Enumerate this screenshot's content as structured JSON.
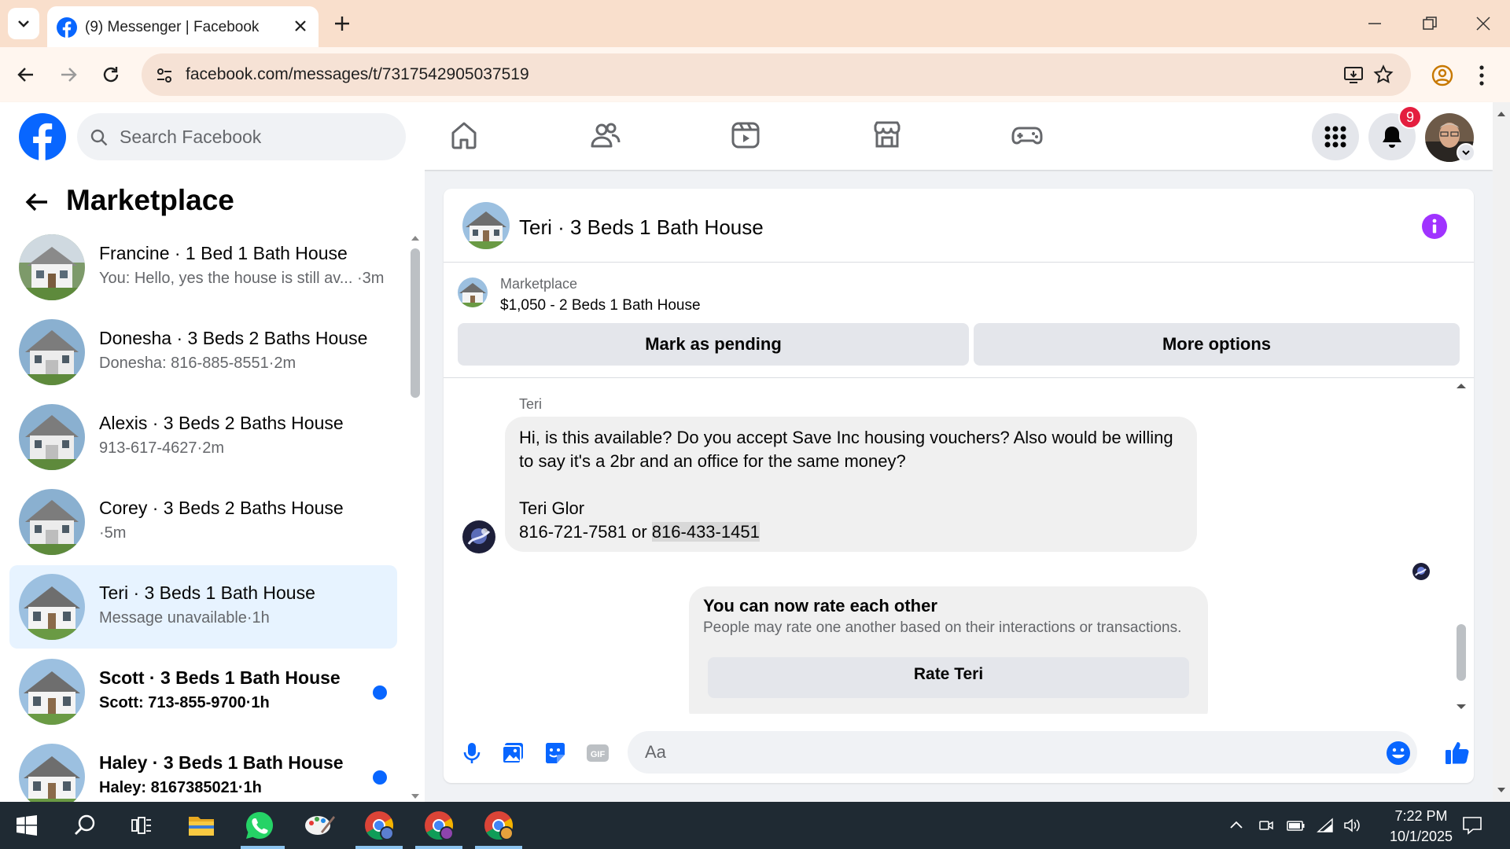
{
  "browser": {
    "tab_title": "(9) Messenger | Facebook",
    "url": "facebook.com/messages/t/7317542905037519"
  },
  "fb_header": {
    "search_placeholder": "Search Facebook",
    "notification_count": "9"
  },
  "sidebar": {
    "title": "Marketplace",
    "conversations": [
      {
        "name": "Francine · 1 Bed 1 Bath House",
        "preview": "You: Hello, yes the house is still av... ·3m",
        "active": false,
        "unread": false
      },
      {
        "name": "Donesha · 3 Beds 2 Baths House",
        "preview": "Donesha: 816-885-8551·2m",
        "active": false,
        "unread": false
      },
      {
        "name": "Alexis · 3 Beds 2 Baths House",
        "preview": "913-617-4627·2m",
        "active": false,
        "unread": false
      },
      {
        "name": "Corey · 3 Beds 2 Baths House",
        "preview": " ·5m",
        "active": false,
        "unread": false
      },
      {
        "name": "Teri · 3 Beds 1 Bath House",
        "preview": "Message unavailable·1h",
        "active": true,
        "unread": false
      },
      {
        "name": "Scott · 3 Beds 1 Bath House",
        "preview": "Scott: 713-855-9700·1h",
        "active": false,
        "unread": true
      },
      {
        "name": "Haley · 3 Beds 1 Bath House",
        "preview": "Haley: 8167385021·1h",
        "active": false,
        "unread": true
      }
    ]
  },
  "chat": {
    "title": "Teri · 3 Beds 1 Bath House",
    "listing_label": "Marketplace",
    "listing_title": "$1,050 - 2 Beds 1 Bath House",
    "mark_pending_label": "Mark as pending",
    "more_options_label": "More options",
    "message": {
      "sender": "Teri",
      "line1": "Hi, is this available? Do you accept Save Inc housing vouchers? Also would be willing to say it's a 2br and an office for the same money?",
      "line2": "Teri Glor",
      "phone_prefix": "816-721-7581 or ",
      "phone_highlighted": "816-433-1451"
    },
    "rate_card": {
      "title": "You can now rate each other",
      "subtitle": "People may rate one another based on their interactions or transactions.",
      "button": "Rate Teri"
    },
    "composer_placeholder": "Aa"
  },
  "taskbar": {
    "time": "7:22 PM",
    "date": "10/1/2025"
  },
  "colors": {
    "fb_blue": "#0866ff",
    "accent_purple": "#a033ff",
    "badge_red": "#e41e3f",
    "chrome_tab_strip": "#f9dfcc"
  }
}
